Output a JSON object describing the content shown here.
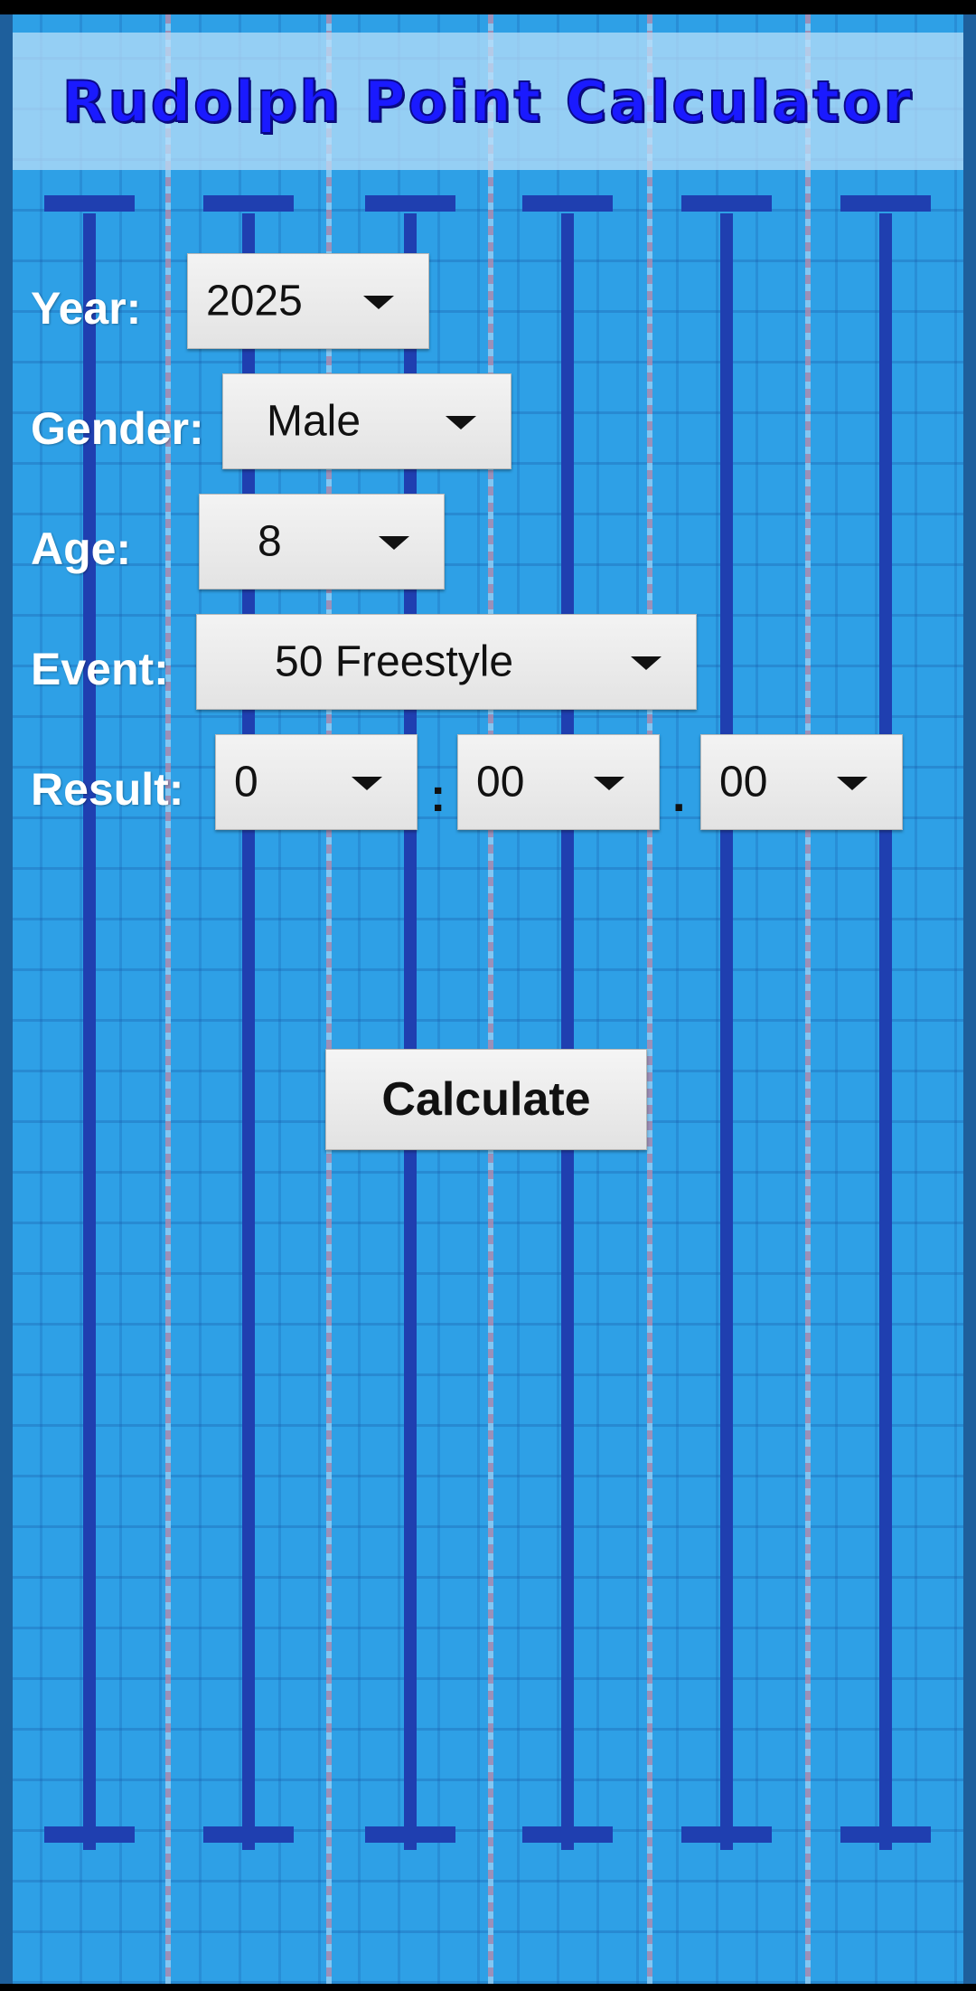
{
  "app": {
    "title": "Rudolph Point Calculator"
  },
  "form": {
    "year": {
      "label": "Year:",
      "value": "2025"
    },
    "gender": {
      "label": "Gender:",
      "value": "Male"
    },
    "age": {
      "label": "Age:",
      "value": "8"
    },
    "event": {
      "label": "Event:",
      "value": "50 Freestyle"
    },
    "result": {
      "label": "Result:",
      "minutes": "0",
      "seconds": "00",
      "hundredths": "00",
      "sep1": ":",
      "sep2": "."
    },
    "calculate_label": "Calculate"
  },
  "icons": {
    "dropdown": "caret-down-icon"
  },
  "colors": {
    "pool": "#2ea0e6",
    "lane": "#1f3fb0",
    "title": "#1a1aff"
  }
}
